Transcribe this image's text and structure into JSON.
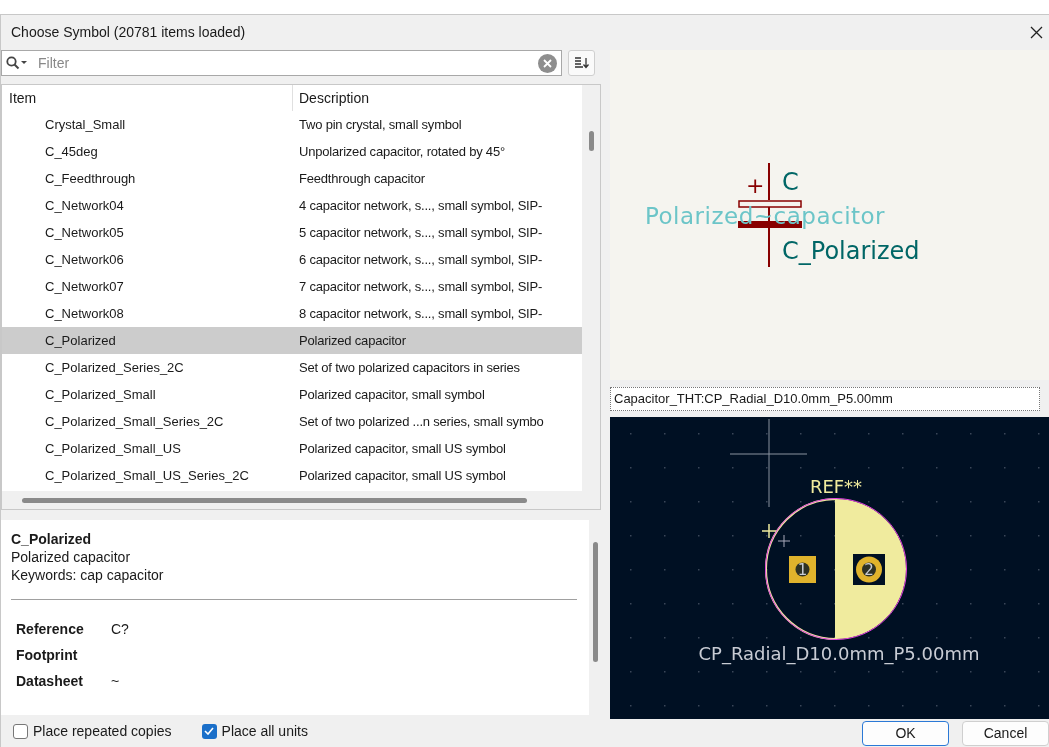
{
  "window": {
    "title": "Choose Symbol (20781 items loaded)"
  },
  "filter": {
    "placeholder": "Filter"
  },
  "table": {
    "columns": [
      "Item",
      "Description"
    ],
    "rows": [
      {
        "item": "Crystal_Small",
        "description": "Two pin crystal, small symbol",
        "selected": false
      },
      {
        "item": "C_45deg",
        "description": "Unpolarized capacitor, rotated by 45°",
        "selected": false
      },
      {
        "item": "C_Feedthrough",
        "description": "Feedthrough capacitor",
        "selected": false
      },
      {
        "item": "C_Network04",
        "description": "4 capacitor network, s..., small symbol, SIP-",
        "selected": false
      },
      {
        "item": "C_Network05",
        "description": "5 capacitor network, s..., small symbol, SIP-",
        "selected": false
      },
      {
        "item": "C_Network06",
        "description": "6 capacitor network, s..., small symbol, SIP-",
        "selected": false
      },
      {
        "item": "C_Network07",
        "description": "7 capacitor network, s..., small symbol, SIP-",
        "selected": false
      },
      {
        "item": "C_Network08",
        "description": "8 capacitor network, s..., small symbol, SIP-",
        "selected": false
      },
      {
        "item": "C_Polarized",
        "description": "Polarized capacitor",
        "selected": true
      },
      {
        "item": "C_Polarized_Series_2C",
        "description": "Set of two polarized capacitors in series",
        "selected": false
      },
      {
        "item": "C_Polarized_Small",
        "description": "Polarized capacitor, small symbol",
        "selected": false
      },
      {
        "item": "C_Polarized_Small_Series_2C",
        "description": "Set of two polarized ...n series, small symbo",
        "selected": false
      },
      {
        "item": "C_Polarized_Small_US",
        "description": "Polarized capacitor, small US symbol",
        "selected": false
      },
      {
        "item": "C_Polarized_Small_US_Series_2C",
        "description": "Polarized capacitor, small US symbol",
        "selected": false
      }
    ]
  },
  "details": {
    "name": "C_Polarized",
    "description": "Polarized capacitor",
    "keywords": "Keywords: cap capacitor",
    "fields": [
      {
        "label": "Reference",
        "value": "C?"
      },
      {
        "label": "Footprint"
      },
      {
        "label": "Datasheet",
        "value": "~"
      }
    ]
  },
  "symbol_preview": {
    "plus": "+",
    "reference": "C",
    "description": "Polarized~capacitor",
    "value": "C_Polarized"
  },
  "footprint": {
    "selection": "Capacitor_THT:CP_Radial_D10.0mm_P5.00mm",
    "reference": "REF**",
    "pads": [
      "1",
      "2"
    ],
    "value": "CP_Radial_D10.0mm_P5.00mm"
  },
  "options": [
    {
      "label": "Place repeated copies",
      "checked": false
    },
    {
      "label": "Place all units",
      "checked": true
    }
  ],
  "buttons": [
    {
      "label": "OK",
      "default": true
    },
    {
      "label": "Cancel",
      "default": false
    }
  ]
}
